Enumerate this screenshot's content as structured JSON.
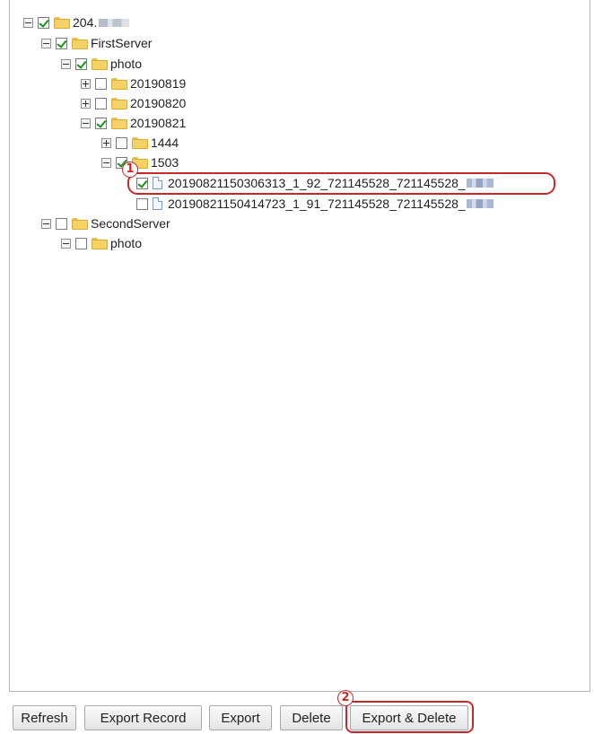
{
  "tree": {
    "root": {
      "label": "204.",
      "checked": true
    },
    "first_server": {
      "label": "FirstServer",
      "checked": true
    },
    "photo1": {
      "label": "photo",
      "checked": true
    },
    "d20190819": {
      "label": "20190819",
      "checked": false
    },
    "d20190820": {
      "label": "20190820",
      "checked": false
    },
    "d20190821": {
      "label": "20190821",
      "checked": true
    },
    "f1444": {
      "label": "1444",
      "checked": false
    },
    "f1503": {
      "label": "1503",
      "checked": true
    },
    "file1": {
      "label": "20190821150306313_1_92_721145528_721145528_",
      "checked": true
    },
    "file2": {
      "label": "20190821150414723_1_91_721145528_721145528_",
      "checked": false
    },
    "second_server": {
      "label": "SecondServer",
      "checked": false
    },
    "photo2": {
      "label": "photo",
      "checked": false
    }
  },
  "callouts": {
    "one": "1",
    "two": "2"
  },
  "buttons": {
    "refresh": "Refresh",
    "export_record": "Export Record",
    "export": "Export",
    "delete": "Delete",
    "export_delete": "Export & Delete"
  },
  "colors": {
    "highlight": "#c42a2a",
    "check": "#1a8f1a",
    "folder": "#f4d266"
  }
}
